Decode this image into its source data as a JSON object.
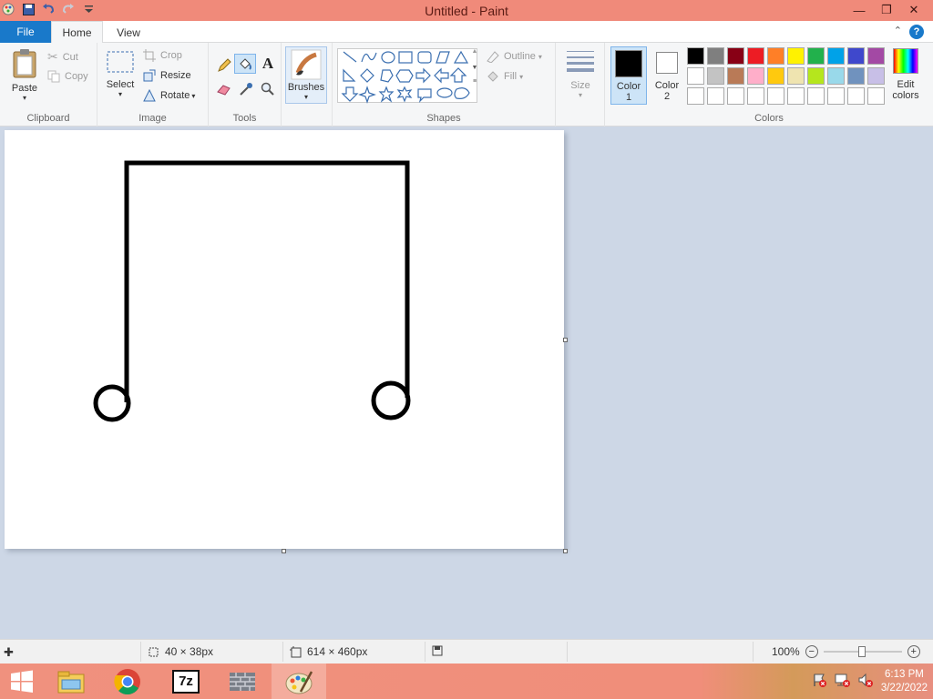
{
  "window": {
    "title": "Untitled - Paint"
  },
  "tabs": {
    "file": "File",
    "home": "Home",
    "view": "View"
  },
  "clipboard": {
    "paste": "Paste",
    "cut": "Cut",
    "copy": "Copy",
    "label": "Clipboard"
  },
  "image": {
    "select": "Select",
    "crop": "Crop",
    "resize": "Resize",
    "rotate": "Rotate",
    "label": "Image"
  },
  "tools": {
    "label": "Tools",
    "text_tool": "A"
  },
  "brushes": {
    "label": "Brushes"
  },
  "shapes": {
    "outline": "Outline",
    "fill": "Fill",
    "label": "Shapes"
  },
  "size": {
    "label": "Size"
  },
  "colors": {
    "color1_label": "Color",
    "color1_num": "1",
    "color2_label": "Color",
    "color2_num": "2",
    "edit_label": "Edit",
    "edit_label2": "colors",
    "label": "Colors",
    "color1": "#000000",
    "color2": "#ffffff",
    "palette_row1": [
      "#000000",
      "#7f7f7f",
      "#880015",
      "#ed1c24",
      "#ff7f27",
      "#fff200",
      "#22b14c",
      "#00a2e8",
      "#3f48cc",
      "#a349a4"
    ],
    "palette_row2": [
      "#ffffff",
      "#c3c3c3",
      "#b97a57",
      "#ffaec9",
      "#ffc90e",
      "#efe4b0",
      "#b5e61d",
      "#99d9ea",
      "#7092be",
      "#c8bfe7"
    ],
    "palette_row3": [
      "#ffffff",
      "#ffffff",
      "#ffffff",
      "#ffffff",
      "#ffffff",
      "#ffffff",
      "#ffffff",
      "#ffffff",
      "#ffffff",
      "#ffffff"
    ]
  },
  "status": {
    "selection_size": "40 × 38px",
    "image_size": "614 × 460px",
    "zoom": "100%"
  },
  "taskbar": {
    "time": "6:13 PM",
    "date": "3/22/2022"
  }
}
